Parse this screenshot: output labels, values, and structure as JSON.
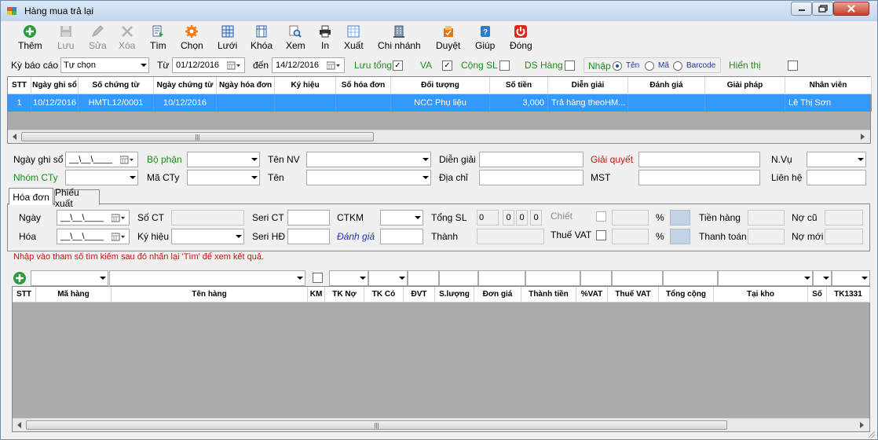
{
  "window": {
    "title": "Hàng mua trả lại"
  },
  "toolbar": [
    {
      "key": "them",
      "label": "Thêm",
      "icon": "add-icon",
      "enabled": true
    },
    {
      "key": "luu",
      "label": "Lưu",
      "icon": "save-icon",
      "enabled": false
    },
    {
      "key": "sua",
      "label": "Sửa",
      "icon": "edit-icon",
      "enabled": false
    },
    {
      "key": "xoa",
      "label": "Xóa",
      "icon": "delete-icon",
      "enabled": false
    },
    {
      "key": "tim",
      "label": "Tìm",
      "icon": "find-icon",
      "enabled": true
    },
    {
      "key": "chon",
      "label": "Chọn",
      "icon": "gear-icon",
      "enabled": true
    },
    {
      "key": "luoi",
      "label": "Lưới",
      "icon": "grid-icon",
      "enabled": true
    },
    {
      "key": "khoa",
      "label": "Khóa",
      "icon": "lock-icon",
      "enabled": true
    },
    {
      "key": "xem",
      "label": "Xem",
      "icon": "preview-icon",
      "enabled": true
    },
    {
      "key": "in",
      "label": "In",
      "icon": "printer-icon",
      "enabled": true
    },
    {
      "key": "xuat",
      "label": "Xuất",
      "icon": "export-icon",
      "enabled": true
    },
    {
      "key": "chinhanh",
      "label": "Chi nhánh",
      "icon": "building-icon",
      "enabled": true
    },
    {
      "key": "duyet",
      "label": "Duyệt",
      "icon": "approve-icon",
      "enabled": true
    },
    {
      "key": "giup",
      "label": "Giúp",
      "icon": "help-icon",
      "enabled": true
    },
    {
      "key": "dong",
      "label": "Đóng",
      "icon": "power-icon",
      "enabled": true
    }
  ],
  "filter": {
    "ky_bao_cao_label": "Kỳ báo cáo",
    "ky_bao_cao_value": "Tự chọn",
    "tu_label": "Từ",
    "tu_value": "01/12/2016",
    "den_label": "đến",
    "den_value": "14/12/2016",
    "luu_tong_label": "Lưu tổng",
    "luu_tong_checked": true,
    "va_label": "VA",
    "va_checked": true,
    "cong_sl_label": "Cộng SL",
    "cong_sl_checked": false,
    "ds_hang_label": "DS Hàng",
    "ds_hang_checked": false,
    "nhap_label": "Nhập",
    "radio_ten": "Tên",
    "radio_ma": "Mã",
    "radio_barcode": "Barcode",
    "hien_thi_label": "Hiển thị",
    "hien_thi_checked": false
  },
  "main_grid": {
    "columns": [
      "STT",
      "Ngày ghi sổ",
      "Số chứng từ",
      "Ngày chứng từ",
      "Ngày hóa đơn",
      "Ký hiệu",
      "Số hóa đơn",
      "Đối tượng",
      "Số tiền",
      "Diễn giải",
      "Đánh giá",
      "Giải pháp",
      "Nhân viên"
    ],
    "rows": [
      [
        "1",
        "10/12/2016",
        "HMTL12/0001",
        "10/12/2016",
        "",
        "",
        "",
        "NCC Phụ liệu",
        "3,000",
        "Trả hàng theoHM...",
        "",
        "",
        "Lê Thị Sơn"
      ]
    ],
    "selection_color": "#3399ff"
  },
  "form": {
    "ngay_ghi_so_label": "Ngày ghi sổ",
    "ngay_ghi_so_value": "__\\__\\____",
    "bo_phan_label": "Bộ phận",
    "ten_nv_label": "Tên NV",
    "dien_giai_label": "Diễn giải",
    "giai_quyet_label": "Giải quyết",
    "nvu_label": "N.Vụ",
    "nhom_cty_label": "Nhóm CTy",
    "ma_cty_label": "Mã CTy",
    "ten_label": "Tên",
    "dia_chi_label": "Địa chỉ",
    "mst_label": "MST",
    "lien_he_label": "Liên hệ"
  },
  "tabs": [
    "Hóa đơn",
    "Phiếu xuất"
  ],
  "invoice": {
    "ngay_label": "Ngày",
    "ngay_value": "__\\__\\____",
    "so_ct_label": "Số CT",
    "seri_ct_label": "Seri CT",
    "ctkm_label": "CTKM",
    "tong_sl_label": "Tổng SL",
    "tong_sl_values": [
      "0",
      "0",
      "0",
      "0"
    ],
    "chiet_label": "Chiết",
    "percent1": "%",
    "tien_hang_label": "Tiền hàng",
    "no_cu_label": "Nợ cũ",
    "hoa_label": "Hóa",
    "hoa_value": "__\\__\\____",
    "ky_hieu_label": "Ký hiệu",
    "seri_hd_label": "Seri HĐ",
    "danh_gia_label": "Đánh giá",
    "thanh_label": "Thành",
    "thue_vat_label": "Thuế VAT",
    "percent2": "%",
    "thanh_toan_label": "Thanh toán",
    "no_moi_label": "Nợ mới"
  },
  "hint": "Nhập vào tham số tìm kiếm sau đó nhấn lại 'Tìm' để xem kết quả.",
  "detail_grid": {
    "columns": [
      "STT",
      "Mã hàng",
      "Tên hàng",
      "KM",
      "TK Nợ",
      "TK Có",
      "ĐVT",
      "S.lượng",
      "Đơn giá",
      "Thành tiền",
      "%VAT",
      "Thuế VAT",
      "Tổng cộng",
      "Tại kho",
      "Số",
      "TK1331"
    ]
  }
}
